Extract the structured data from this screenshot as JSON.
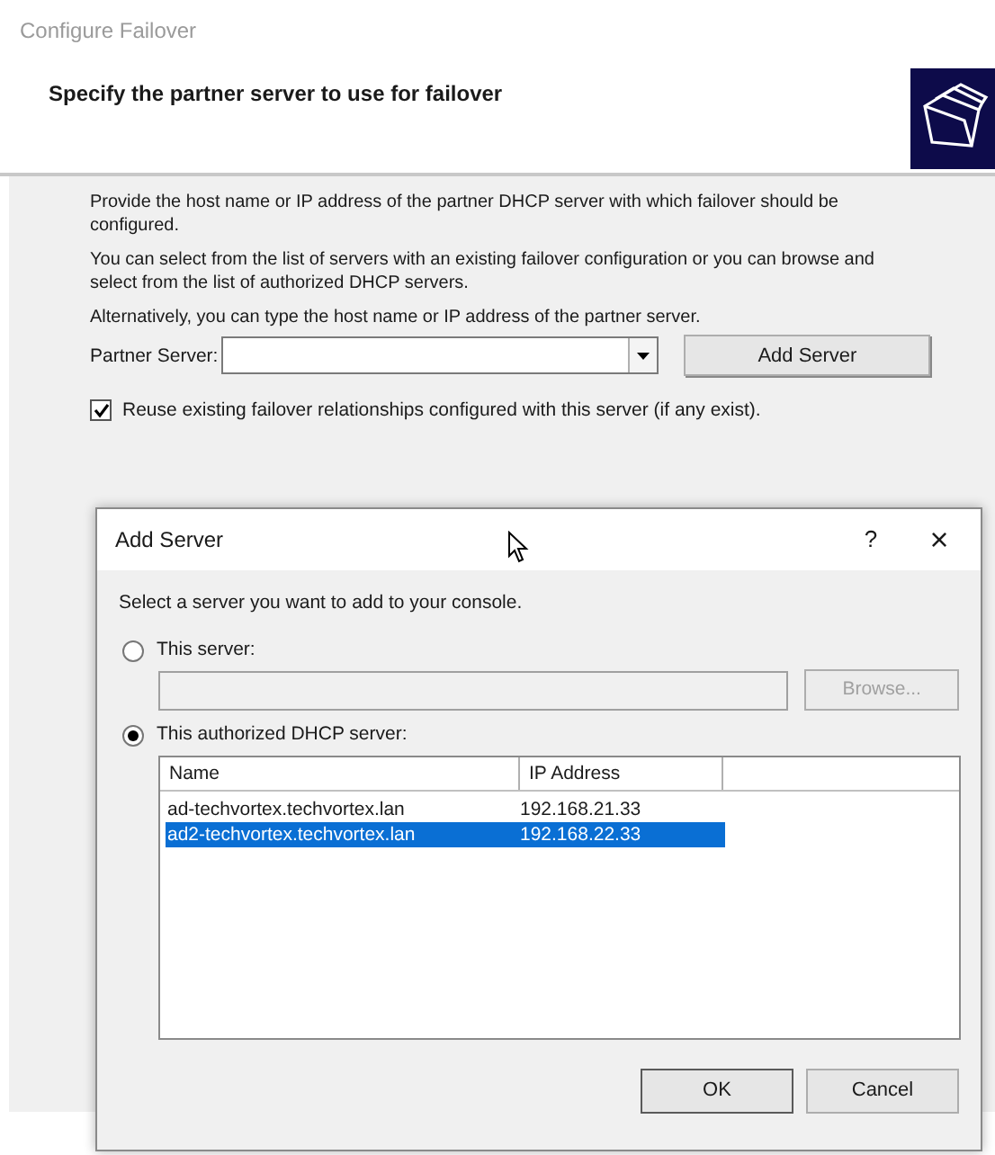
{
  "window": {
    "title": "Configure Failover"
  },
  "header": {
    "title": "Specify the partner server to use for failover"
  },
  "paragraphs": [
    "Provide the host name or IP address of the partner DHCP server with which failover should be configured.",
    "You can select from the list of servers with an existing failover configuration or you can browse and select from the list of authorized DHCP servers.",
    "Alternatively, you can type the host name or IP address of the partner server."
  ],
  "partner_server": {
    "label": "Partner Server:",
    "add_button": "Add Server"
  },
  "reuse_checkbox": {
    "label": "Reuse existing failover relationships configured with this server (if any exist).",
    "checked": true
  },
  "dialog": {
    "title": "Add Server",
    "help": "?",
    "close": "×",
    "instruction": "Select a server you want to add to your console.",
    "options": [
      {
        "label": "This server:",
        "selected": false
      },
      {
        "label": "This authorized DHCP server:",
        "selected": true
      }
    ],
    "browse_button": {
      "label": "Browse...",
      "disabled": true
    },
    "list": {
      "columns": [
        "Name",
        "IP Address"
      ],
      "rows": [
        {
          "name": "ad-techvortex.techvortex.lan",
          "ip": "192.168.21.33",
          "selected": false
        },
        {
          "name": "ad2-techvortex.techvortex.lan",
          "ip": "192.168.22.33",
          "selected": true
        }
      ]
    },
    "buttons": [
      "OK",
      "Cancel"
    ]
  }
}
